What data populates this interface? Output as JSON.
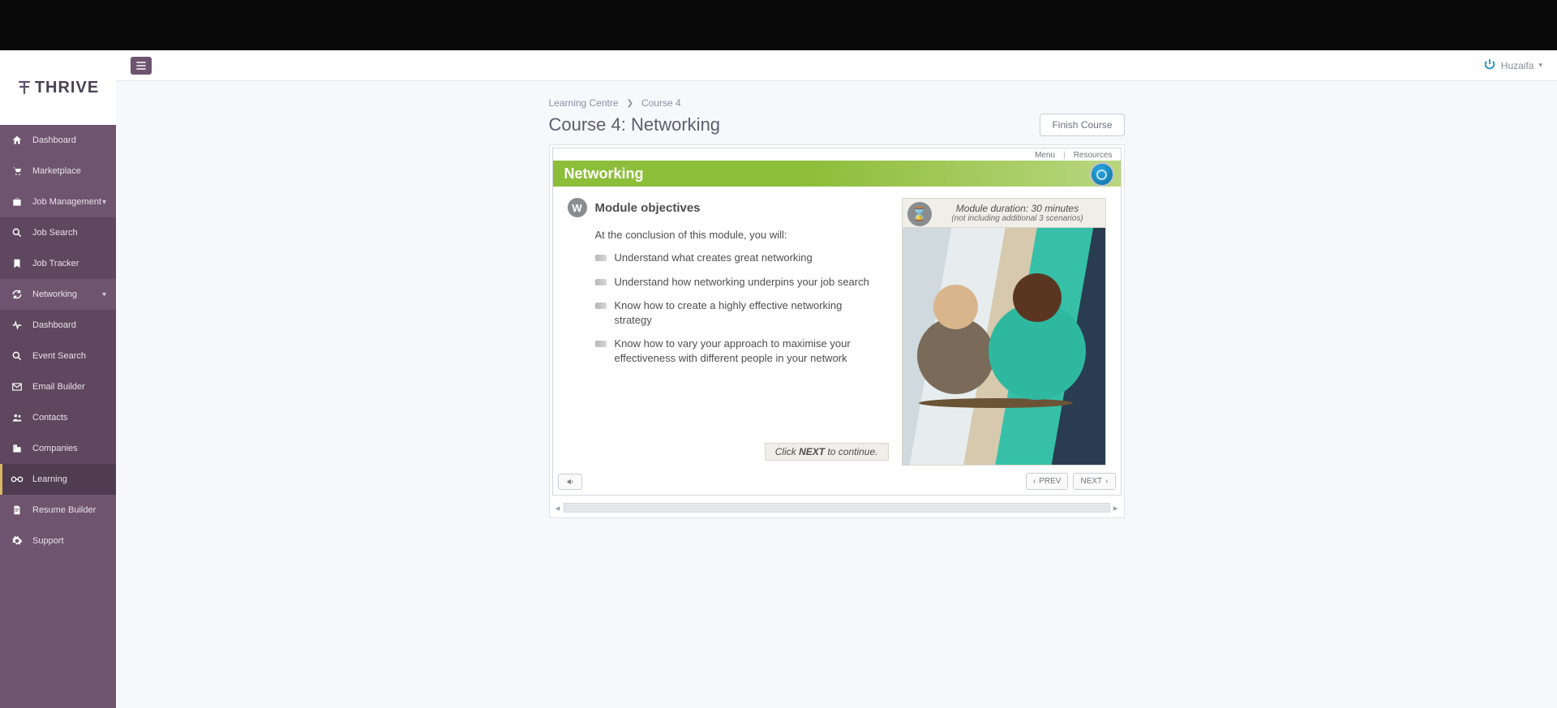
{
  "brand": "THRIVE",
  "user": {
    "name": "Huzaifa"
  },
  "sidebar": {
    "items": [
      {
        "label": "Dashboard",
        "icon": "home"
      },
      {
        "label": "Marketplace",
        "icon": "cart"
      },
      {
        "label": "Job Management",
        "icon": "briefcase",
        "expandable": true
      },
      {
        "label": "Job Search",
        "icon": "search",
        "sub": true
      },
      {
        "label": "Job Tracker",
        "icon": "bookmark",
        "sub": true
      },
      {
        "label": "Networking",
        "icon": "refresh",
        "expandable": true
      },
      {
        "label": "Dashboard",
        "icon": "pulse",
        "sub": true
      },
      {
        "label": "Event Search",
        "icon": "search",
        "sub": true
      },
      {
        "label": "Email Builder",
        "icon": "mail",
        "sub": true
      },
      {
        "label": "Contacts",
        "icon": "people",
        "sub": true
      },
      {
        "label": "Companies",
        "icon": "company",
        "sub": true
      },
      {
        "label": "Learning",
        "icon": "learning",
        "active": true
      },
      {
        "label": "Resume Builder",
        "icon": "doc"
      },
      {
        "label": "Support",
        "icon": "cog"
      }
    ]
  },
  "breadcrumb": {
    "root": "Learning Centre",
    "leaf": "Course 4"
  },
  "page": {
    "title": "Course 4: Networking",
    "finish": "Finish Course"
  },
  "player": {
    "top": {
      "menu": "Menu",
      "resources": "Resources"
    },
    "banner": "Networking",
    "module_title": "Module objectives",
    "intro": "At the conclusion of this module, you will:",
    "objectives": [
      "Understand what creates great networking",
      "Understand how networking underpins your job search",
      "Know how to create a highly effective networking strategy",
      "Know how to vary your approach to maximise your effectiveness with different people in your network"
    ],
    "duration": {
      "line1": "Module duration: 30 minutes",
      "line2": "(not including additional 3 scenarios)"
    },
    "hint_pre": "Click ",
    "hint_bold": "NEXT",
    "hint_post": " to continue.",
    "nav": {
      "prev": "PREV",
      "next": "NEXT"
    }
  }
}
